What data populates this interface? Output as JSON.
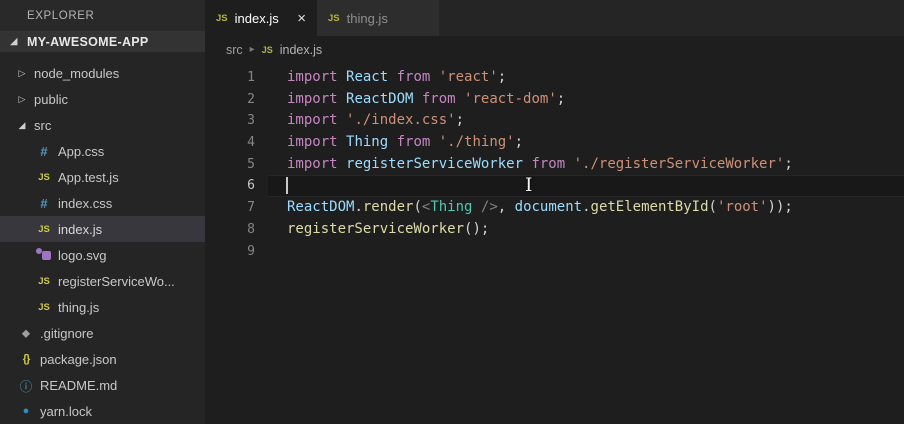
{
  "sidebar": {
    "header": "EXPLORER",
    "root_folder": "MY-AWESOME-APP",
    "items": [
      {
        "label": "node_modules",
        "kind": "folder",
        "state": "collapsed",
        "indent": 1
      },
      {
        "label": "public",
        "kind": "folder",
        "state": "collapsed",
        "indent": 1
      },
      {
        "label": "src",
        "kind": "folder",
        "state": "expanded",
        "indent": 1
      },
      {
        "label": "App.css",
        "kind": "file",
        "icon": "css-icon",
        "indent": 2
      },
      {
        "label": "App.test.js",
        "kind": "file",
        "icon": "js-icon",
        "indent": 2
      },
      {
        "label": "index.css",
        "kind": "file",
        "icon": "css-icon",
        "indent": 2
      },
      {
        "label": "index.js",
        "kind": "file",
        "icon": "js-icon",
        "indent": 2,
        "selected": true
      },
      {
        "label": "logo.svg",
        "kind": "file",
        "icon": "svg-icon",
        "indent": 2
      },
      {
        "label": "registerServiceWo...",
        "kind": "file",
        "icon": "js-icon",
        "indent": 2
      },
      {
        "label": "thing.js",
        "kind": "file",
        "icon": "js-icon",
        "indent": 2
      },
      {
        "label": ".gitignore",
        "kind": "file",
        "icon": "git-icon",
        "indent": 1
      },
      {
        "label": "package.json",
        "kind": "file",
        "icon": "json-icon",
        "indent": 1
      },
      {
        "label": "README.md",
        "kind": "file",
        "icon": "info-icon",
        "indent": 1
      },
      {
        "label": "yarn.lock",
        "kind": "file",
        "icon": "yarn-icon",
        "indent": 1
      }
    ],
    "glyphs": {
      "js-icon": "JS",
      "css-icon": "#",
      "json-icon": "{}",
      "info-icon": "ⓘ",
      "git-icon": "⬥",
      "yarn-icon": "●",
      "twisty_collapsed": "▷",
      "twisty_expanded": "◢"
    }
  },
  "tabs": [
    {
      "label": "index.js",
      "active": true,
      "close_glyph": "×"
    },
    {
      "label": "thing.js",
      "active": false
    }
  ],
  "breadcrumb": {
    "folder": "src",
    "separator": "▸",
    "file": "index.js"
  },
  "editor": {
    "token_colors": {
      "kw": "#C586C0",
      "var": "#9CDCFE",
      "str": "#CE9178",
      "pl": "#D4D4D4",
      "fn": "#DCDCAA",
      "jsxt": "#4EC9B0",
      "jsxp": "#808080"
    },
    "lines": [
      {
        "num": "1",
        "tokens": [
          {
            "t": "import ",
            "c": "kw"
          },
          {
            "t": "React ",
            "c": "var"
          },
          {
            "t": "from ",
            "c": "kw"
          },
          {
            "t": "'react'",
            "c": "str"
          },
          {
            "t": ";",
            "c": "pl"
          }
        ]
      },
      {
        "num": "2",
        "tokens": [
          {
            "t": "import ",
            "c": "kw"
          },
          {
            "t": "ReactDOM ",
            "c": "var"
          },
          {
            "t": "from ",
            "c": "kw"
          },
          {
            "t": "'react-dom'",
            "c": "str"
          },
          {
            "t": ";",
            "c": "pl"
          }
        ]
      },
      {
        "num": "3",
        "tokens": [
          {
            "t": "import ",
            "c": "kw"
          },
          {
            "t": "'./index.css'",
            "c": "str"
          },
          {
            "t": ";",
            "c": "pl"
          }
        ]
      },
      {
        "num": "4",
        "tokens": [
          {
            "t": "import ",
            "c": "kw"
          },
          {
            "t": "Thing ",
            "c": "var"
          },
          {
            "t": "from ",
            "c": "kw"
          },
          {
            "t": "'./thing'",
            "c": "str"
          },
          {
            "t": ";",
            "c": "pl"
          }
        ]
      },
      {
        "num": "5",
        "tokens": [
          {
            "t": "import ",
            "c": "kw"
          },
          {
            "t": "registerServiceWorker ",
            "c": "var"
          },
          {
            "t": "from ",
            "c": "kw"
          },
          {
            "t": "'./registerServiceWorker'",
            "c": "str"
          },
          {
            "t": ";",
            "c": "pl"
          }
        ]
      },
      {
        "num": "6",
        "tokens": [],
        "current": true,
        "caret": true
      },
      {
        "num": "7",
        "tokens": [
          {
            "t": "ReactDOM",
            "c": "var"
          },
          {
            "t": ".",
            "c": "pl"
          },
          {
            "t": "render",
            "c": "fn"
          },
          {
            "t": "(",
            "c": "pl"
          },
          {
            "t": "<",
            "c": "jsxp"
          },
          {
            "t": "Thing",
            "c": "jsxt"
          },
          {
            "t": " ",
            "c": "pl"
          },
          {
            "t": "/>",
            "c": "jsxp"
          },
          {
            "t": ", ",
            "c": "pl"
          },
          {
            "t": "document",
            "c": "var"
          },
          {
            "t": ".",
            "c": "pl"
          },
          {
            "t": "getElementById",
            "c": "fn"
          },
          {
            "t": "(",
            "c": "pl"
          },
          {
            "t": "'root'",
            "c": "str"
          },
          {
            "t": "));",
            "c": "pl"
          }
        ]
      },
      {
        "num": "8",
        "tokens": [
          {
            "t": "registerServiceWorker",
            "c": "fn"
          },
          {
            "t": "();",
            "c": "pl"
          }
        ]
      },
      {
        "num": "9",
        "tokens": []
      }
    ]
  },
  "cursor": {
    "ibeam_glyph": "I"
  },
  "colors": {
    "editor_bg": "#1e1e1e",
    "sidebar_bg": "#252526",
    "tab_inactive_bg": "#2d2d2d",
    "selection_row_bg": "#37373d",
    "js_icon": "#cbcb41",
    "css_icon": "#519aba",
    "svg_icon": "#a074c4",
    "yarn_icon": "#2c8ebb"
  }
}
